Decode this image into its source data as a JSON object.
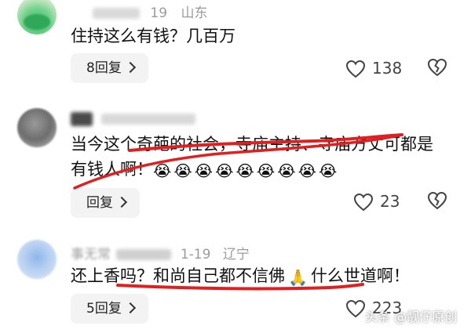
{
  "comments": [
    {
      "region": "山东",
      "date_fragment": "19",
      "text": "住持这么有钱？几百万",
      "reply_label": "8回复",
      "likes": "138"
    },
    {
      "text_line1": "当今这个奇葩的社会，寺庙主持、寺庙方丈可都是",
      "text_line2": "有钱人啊！",
      "emoji": "😭",
      "emoji_count": 9,
      "reply_label": "回复",
      "likes": "23"
    },
    {
      "author_fragment": "事无常",
      "date": "1-19",
      "region": "辽宁",
      "text_part1": "还上香吗？和尚自己都不信佛",
      "emoji": "🙏",
      "text_part2": "什么世道啊！",
      "reply_label": "5回复",
      "likes": "223"
    }
  ],
  "watermark": "头条 @靓仔原创",
  "colors": {
    "annotation_red": "#e02020",
    "button_bg": "#f3f3f3",
    "meta_gray": "#9b9b9b"
  },
  "icons": {
    "like": "heart-outline-icon",
    "dislike": "broken-heart-icon",
    "chevron": "chevron-right-icon"
  }
}
